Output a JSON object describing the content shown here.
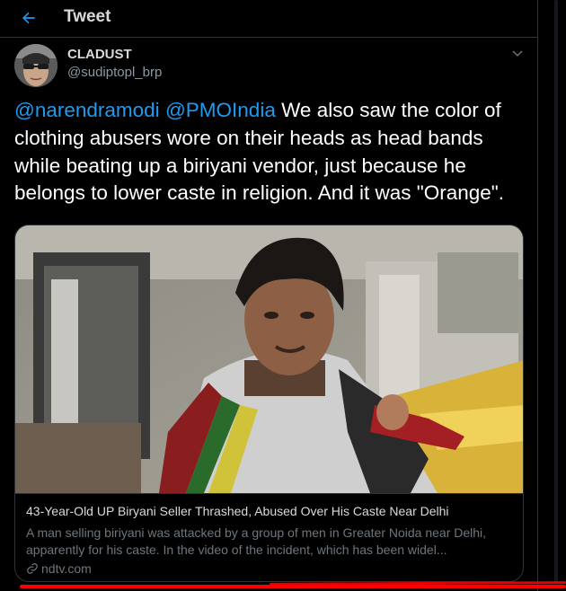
{
  "header": {
    "back_icon": "arrow-left-icon",
    "title": "Tweet"
  },
  "tweet": {
    "display_name": "CLADUST",
    "handle": "@sudiptopl_brp",
    "more_icon": "chevron-down-icon",
    "mention_1": "@narendramodi",
    "mention_2": "@PMOIndia",
    "body": " We also saw the color of clothing abusers wore on their heads as head bands while beating up a biriyani vendor, just because he belongs to lower caste in religion. And it was  \"Orange\"."
  },
  "card": {
    "title": "43-Year-Old UP Biryani Seller Thrashed, Abused Over His Caste Near Delhi",
    "description": "A man selling biriyani was attacked by a group of men in Greater Noida near Delhi, apparently for his caste. In the video of the incident, which has been widel...",
    "domain_icon": "link-icon",
    "domain": "ndtv.com"
  },
  "colors": {
    "background": "#000000",
    "accent": "#1d9bf0",
    "secondary_text": "#6e767d",
    "border": "#2f3336",
    "annotation_red": "#ff0000"
  }
}
